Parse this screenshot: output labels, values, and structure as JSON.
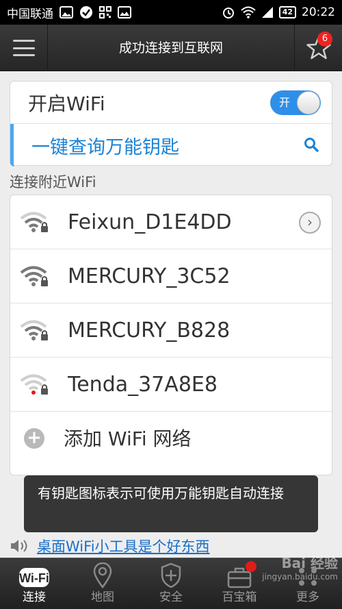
{
  "status_bar": {
    "carrier": "中国联通",
    "battery": "42",
    "time": "20:22"
  },
  "header": {
    "title": "成功连接到互联网",
    "badge_count": "6"
  },
  "wifi_toggle": {
    "label": "开启WiFi",
    "state_label": "开",
    "on": true
  },
  "key_query": {
    "label": "一键查询万能钥匙"
  },
  "section": {
    "nearby_label": "连接附近WiFi"
  },
  "networks": [
    {
      "ssid": "Feixun_D1E4DD",
      "has_key": true,
      "signal": "strong",
      "connected": true
    },
    {
      "ssid": "MERCURY_3C52",
      "has_key": true,
      "signal": "strong",
      "connected": false
    },
    {
      "ssid": "MERCURY_B828",
      "has_key": true,
      "signal": "medium",
      "connected": false
    },
    {
      "ssid": "Tenda_37A8E8",
      "has_key": true,
      "signal": "weak",
      "connected": false
    }
  ],
  "add_network": {
    "label": "添加 WiFi 网络"
  },
  "toast": {
    "text": "有钥匙图标表示可使用万能钥匙自动连接"
  },
  "tip": {
    "text": "桌面WiFi小工具是个好东西"
  },
  "bottom_nav": [
    {
      "label": "连接",
      "icon": "wifi-icon",
      "active": true
    },
    {
      "label": "地图",
      "icon": "map-pin-icon",
      "active": false
    },
    {
      "label": "安全",
      "icon": "shield-icon",
      "active": false
    },
    {
      "label": "百宝箱",
      "icon": "toolbox-icon",
      "active": false
    },
    {
      "label": "更多",
      "icon": "more-icon",
      "active": false
    }
  ],
  "watermark": {
    "line1": "Bai 经验",
    "line2": "jingyan.baidu.com"
  },
  "colors": {
    "accent": "#2f8fe8",
    "key_text": "#1a83d6",
    "badge": "#e22222"
  }
}
